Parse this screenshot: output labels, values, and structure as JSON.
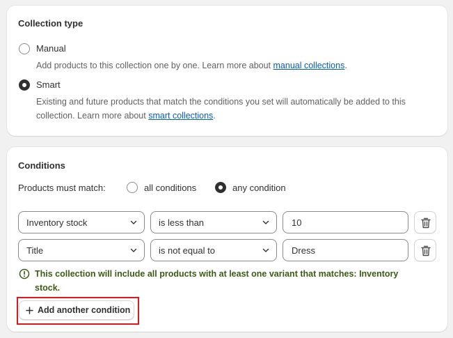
{
  "collection_type": {
    "title": "Collection type",
    "options": [
      {
        "label": "Manual",
        "selected": false,
        "help_prefix": "Add products to this collection one by one. Learn more about ",
        "help_link": "manual collections",
        "help_suffix": "."
      },
      {
        "label": "Smart",
        "selected": true,
        "help_line1": "Existing and future products that match the conditions you set will automatically be added to this",
        "help_prefix": "collection. Learn more about ",
        "help_link": "smart collections",
        "help_suffix": "."
      }
    ]
  },
  "conditions": {
    "title": "Conditions",
    "match_label": "Products must match:",
    "match_options": [
      {
        "label": "all conditions",
        "selected": false
      },
      {
        "label": "any condition",
        "selected": true
      }
    ],
    "rows": [
      {
        "field": "Inventory stock",
        "operator": "is less than",
        "value": "10"
      },
      {
        "field": "Title",
        "operator": "is not equal to",
        "value": "Dress"
      }
    ],
    "notice_line1": "This collection will include all products with at least one variant that matches: Inventory",
    "notice_line2": "stock.",
    "add_button": "Add another condition"
  },
  "colors": {
    "link": "#005bd3",
    "notice_text": "#3c5a14",
    "highlight": "#e3171b"
  },
  "icons": {
    "notice": "alert-circle-icon",
    "delete": "trash-icon",
    "add": "plus-icon",
    "select": "chevron-down-icon"
  }
}
